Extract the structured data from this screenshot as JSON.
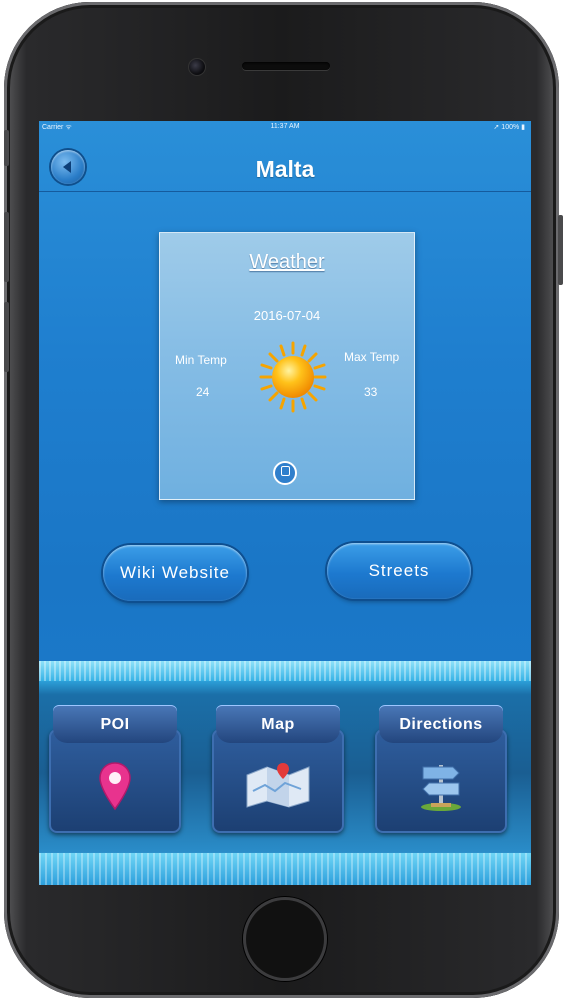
{
  "statusbar": {
    "carrier": "Carrier ᯤ",
    "time": "11:37 AM",
    "battery": "➚ 100% ▮"
  },
  "navbar": {
    "title": "Malta",
    "back_icon": "back-arrow-icon"
  },
  "weather": {
    "title": "Weather",
    "date": "2016-07-04",
    "min_label": "Min Temp",
    "min_value": "24",
    "max_label": "Max Temp",
    "max_value": "33",
    "icon": "sun-icon"
  },
  "buttons": {
    "wiki": "Wiki Website",
    "streets": "Streets"
  },
  "tiles": [
    {
      "label": "POI",
      "icon": "map-pin-icon"
    },
    {
      "label": "Map",
      "icon": "folded-map-icon"
    },
    {
      "label": "Directions",
      "icon": "signpost-icon"
    }
  ],
  "colors": {
    "accent_blue": "#1f7fcf",
    "pin_pink": "#e8338e",
    "tile_navy": "#23467e"
  }
}
